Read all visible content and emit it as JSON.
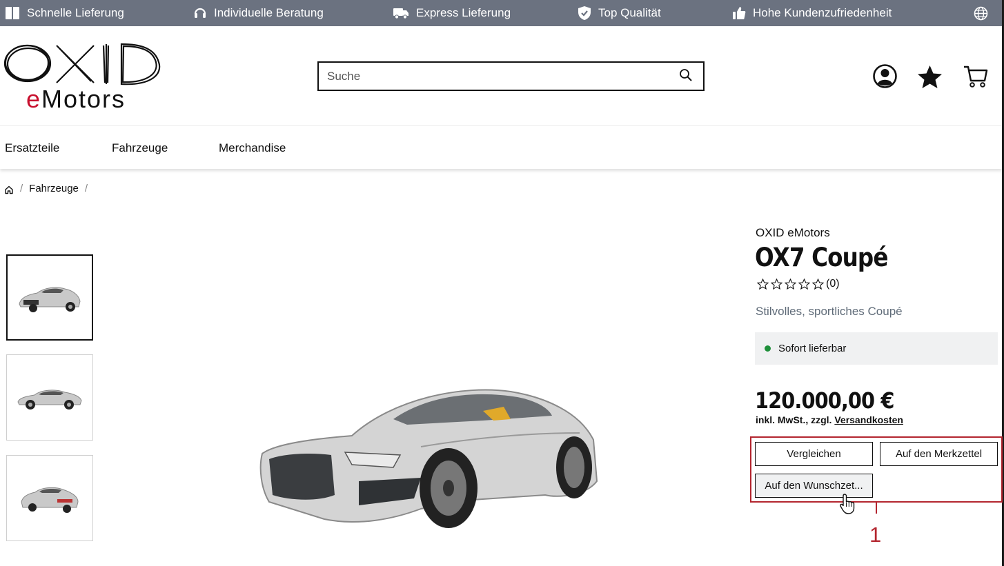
{
  "topbar": {
    "usps": [
      {
        "icon": "gift-box-icon",
        "label": "Schnelle Lieferung"
      },
      {
        "icon": "headset-icon",
        "label": "Individuelle Beratung"
      },
      {
        "icon": "truck-icon",
        "label": "Express Lieferung"
      },
      {
        "icon": "shield-check-icon",
        "label": "Top Qualität"
      },
      {
        "icon": "thumbs-up-icon",
        "label": "Hohe Kundenzufriedenheit"
      }
    ],
    "language_icon": "globe-icon"
  },
  "header": {
    "logo": {
      "line1": "OXID",
      "line2_accent": "e",
      "line2_rest": "Motors"
    },
    "search": {
      "placeholder": "Suche",
      "value": ""
    },
    "icons": [
      "account-icon",
      "wishlist-star-icon",
      "cart-icon"
    ]
  },
  "nav": {
    "items": [
      "Ersatzteile",
      "Fahrzeuge",
      "Merchandise"
    ]
  },
  "breadcrumb": {
    "items": [
      "Fahrzeuge"
    ]
  },
  "product": {
    "brand": "OXID eMotors",
    "title": "OX7 Coupé",
    "rating_count": "(0)",
    "rating_value": 0,
    "rating_max": 5,
    "short_description": "Stilvolles, sportliches Coupé",
    "stock_text": "Sofort lieferbar",
    "stock_color": "#1e8f3a",
    "price": "120.000,00 €",
    "vat_text": "inkl. MwSt., zzgl.",
    "shipping_link": "Versandkosten",
    "buttons": {
      "compare": "Vergleichen",
      "notice_list": "Auf den Merkzettel",
      "wish_list": "Auf den Wunschzet..."
    },
    "thumbnails": [
      "car-front-view",
      "car-side-view",
      "car-rear-view"
    ]
  },
  "annotation": {
    "callout_number": "1",
    "color": "#b3252f"
  },
  "colors": {
    "topbar_bg": "#6b7280",
    "logo_accent": "#c8102e"
  }
}
